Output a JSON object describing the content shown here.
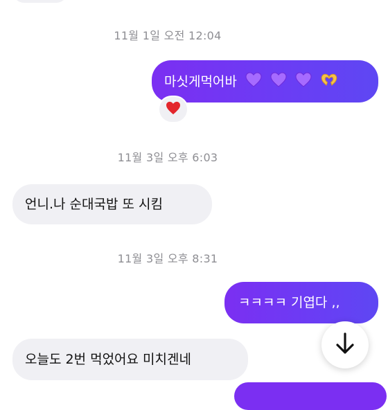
{
  "thread": {
    "timestamps": [
      "11월 1일 오전 12:04",
      "11월 3일 오후 6:03",
      "11월 3일 오후 8:31"
    ],
    "messages": [
      {
        "direction": "outgoing",
        "text": "마싯게먹어바",
        "emoji": [
          "purple-heart",
          "purple-heart",
          "purple-heart",
          "heart-hands"
        ],
        "reaction": "red-heart"
      },
      {
        "direction": "incoming",
        "text": "언니.나 순대국밥 또 시킴"
      },
      {
        "direction": "outgoing",
        "text": "ㅋㅋㅋㅋ 기엽다 ,,"
      },
      {
        "direction": "incoming",
        "text": "오늘도 2번 먹었어요 미치겐네"
      }
    ]
  },
  "controls": {
    "scroll_button_icon": "arrow-down-icon"
  },
  "colors": {
    "outgoing_bubble": "#7b2ff2",
    "incoming_bubble": "#f0f0f4",
    "timestamp_text": "#8e8e93",
    "reaction_heart": "#e02424"
  }
}
